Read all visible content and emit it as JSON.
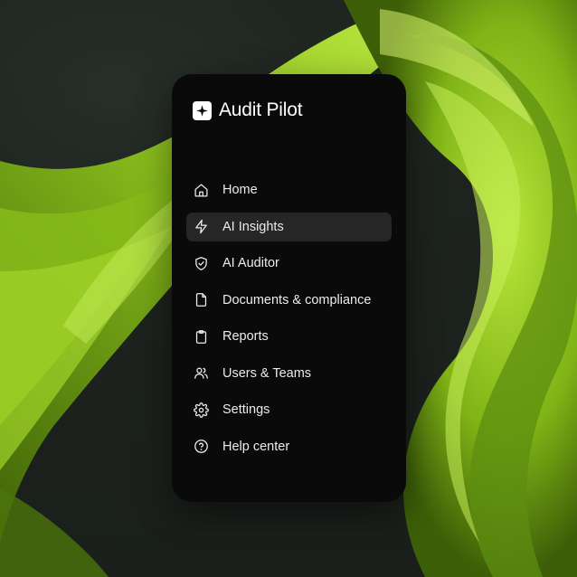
{
  "app": {
    "title": "Audit Pilot"
  },
  "colors": {
    "panel": "#0a0a0a",
    "active": "#262626",
    "accent": "#9fd12b",
    "text": "#ececec"
  },
  "nav": {
    "items": [
      {
        "label": "Home",
        "icon": "home-icon",
        "active": false
      },
      {
        "label": "AI Insights",
        "icon": "lightning-icon",
        "active": true
      },
      {
        "label": "AI Auditor",
        "icon": "shield-check-icon",
        "active": false
      },
      {
        "label": "Documents & compliance",
        "icon": "document-icon",
        "active": false
      },
      {
        "label": "Reports",
        "icon": "clipboard-icon",
        "active": false
      },
      {
        "label": "Users & Teams",
        "icon": "users-icon",
        "active": false
      },
      {
        "label": "Settings",
        "icon": "gear-icon",
        "active": false
      },
      {
        "label": "Help center",
        "icon": "help-circle-icon",
        "active": false
      }
    ]
  }
}
